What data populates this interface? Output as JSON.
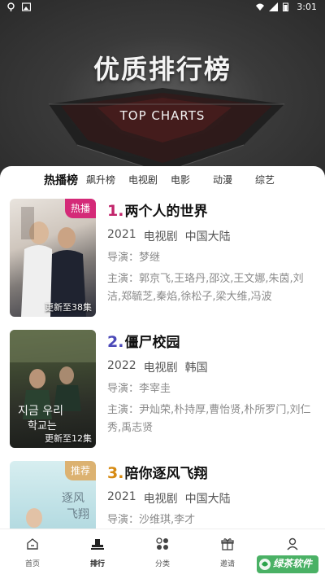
{
  "status_bar": {
    "time": "3:01"
  },
  "hero": {
    "title": "优质排行榜",
    "subtitle": "TOP CHARTS"
  },
  "tabs": [
    {
      "label": "热播榜",
      "active": true
    },
    {
      "label": "飙升榜",
      "active": false
    },
    {
      "label": "电视剧",
      "active": false
    },
    {
      "label": "电影",
      "active": false
    },
    {
      "label": "动漫",
      "active": false
    },
    {
      "label": "综艺",
      "active": false
    }
  ],
  "items": [
    {
      "rank": "1.",
      "title": "两个人的世界",
      "rank_color": "#c2256b",
      "badge": "热播",
      "badge_color": "#d42a78",
      "episode": "更新至38集",
      "year": "2021",
      "type": "电视剧",
      "region": "中国大陆",
      "director": "导演：梦继",
      "cast": "主演：郭京飞,王珞丹,邵汶,王文娜,朱茵,刘洁,郑毓芝,秦焰,徐松子,梁大维,冯波"
    },
    {
      "rank": "2.",
      "title": "僵尸校园",
      "rank_color": "#4c4ab8",
      "badge": "",
      "badge_color": "",
      "episode": "更新至12集",
      "year": "2022",
      "type": "电视剧",
      "region": "韩国",
      "director": "导演：李宰圭",
      "cast": "主演：尹灿荣,朴持厚,曹怡贤,朴所罗门,刘仁秀,禹志贤"
    },
    {
      "rank": "3.",
      "title": "陪你逐风飞翔",
      "rank_color": "#d68a12",
      "badge": "推荐",
      "badge_color": "#dcb271",
      "episode": "",
      "year": "2021",
      "type": "电视剧",
      "region": "中国大陆",
      "director": "导演：沙维琪,李才",
      "cast": ""
    }
  ],
  "bottom_nav": [
    {
      "label": "首页",
      "icon": "home-icon",
      "active": false
    },
    {
      "label": "排行",
      "icon": "ranking-icon",
      "active": true
    },
    {
      "label": "分类",
      "icon": "category-icon",
      "active": false
    },
    {
      "label": "邀请",
      "icon": "gift-icon",
      "active": false
    },
    {
      "label": "我的",
      "icon": "user-icon",
      "active": false
    }
  ],
  "watermark": {
    "text": "绿茶软件"
  }
}
